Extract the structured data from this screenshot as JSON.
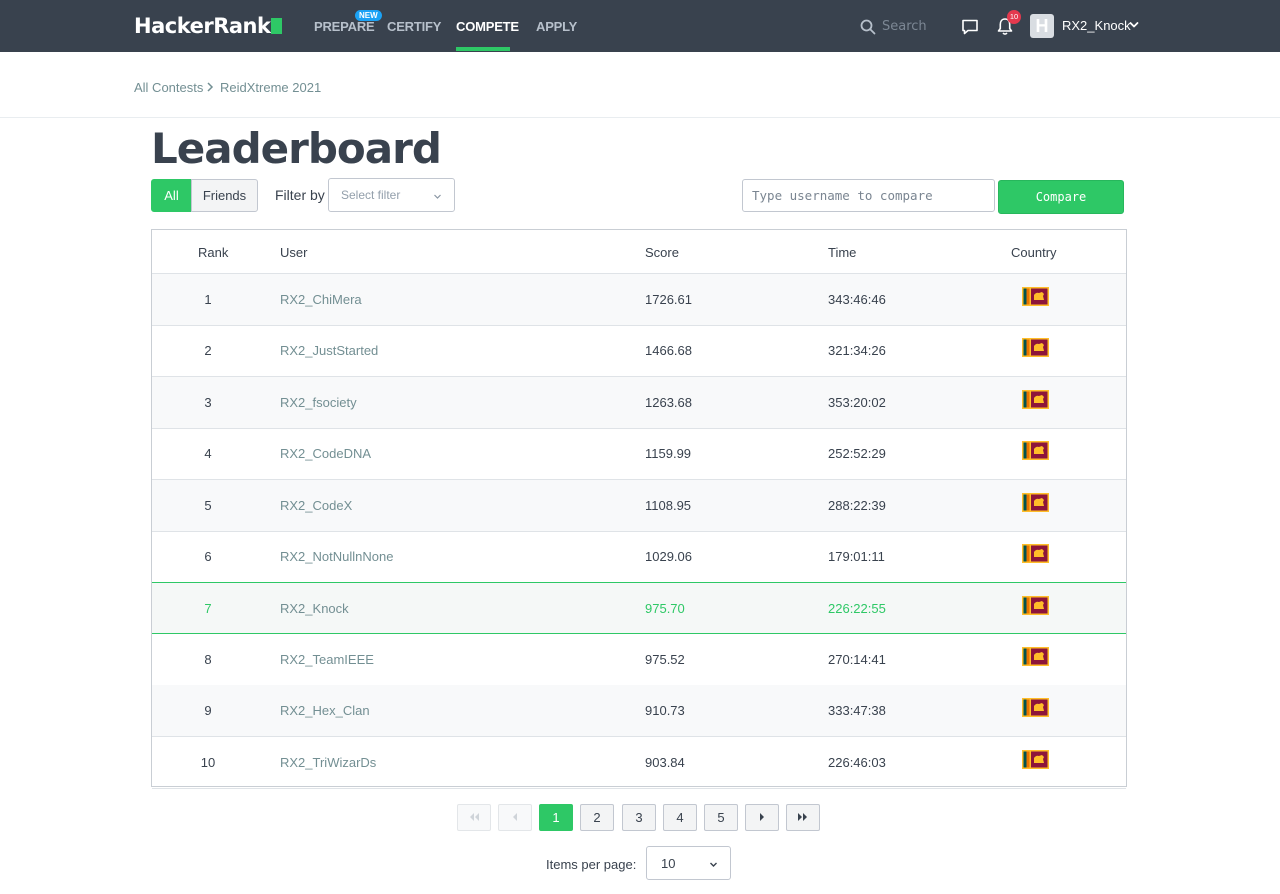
{
  "brand": {
    "name": "HackerRank",
    "accent": "#2ec866",
    "nav_bg": "#39424e"
  },
  "nav": {
    "items": [
      {
        "label": "PREPARE",
        "badge": "NEW"
      },
      {
        "label": "CERTIFY"
      },
      {
        "label": "COMPETE",
        "active": true
      },
      {
        "label": "APPLY"
      }
    ],
    "search_placeholder": "Search",
    "notification_count": "10",
    "avatar_letter": "H",
    "username": "RX2_Knock",
    "icons": [
      "search-icon",
      "chat-icon",
      "bell-icon",
      "chevron-down-icon"
    ]
  },
  "breadcrumb": {
    "items": [
      "All Contests",
      "ReidXtreme 2021"
    ]
  },
  "page": {
    "title": "Leaderboard"
  },
  "filters": {
    "all_label": "All",
    "friends_label": "Friends",
    "filter_label": "Filter by",
    "filter_placeholder": "Select filter",
    "compare_placeholder": "Type username to compare",
    "compare_label": "Compare"
  },
  "table": {
    "headers": {
      "rank": "Rank",
      "user": "User",
      "score": "Score",
      "time": "Time",
      "country": "Country"
    },
    "rows": [
      {
        "rank": "1",
        "user": "RX2_ChiMera",
        "score": "1726.61",
        "time": "343:46:46",
        "country_flag": "sri-lanka-flag-icon"
      },
      {
        "rank": "2",
        "user": "RX2_JustStarted",
        "score": "1466.68",
        "time": "321:34:26",
        "country_flag": "sri-lanka-flag-icon"
      },
      {
        "rank": "3",
        "user": "RX2_fsociety",
        "score": "1263.68",
        "time": "353:20:02",
        "country_flag": "sri-lanka-flag-icon"
      },
      {
        "rank": "4",
        "user": "RX2_CodeDNA",
        "score": "1159.99",
        "time": "252:52:29",
        "country_flag": "sri-lanka-flag-icon"
      },
      {
        "rank": "5",
        "user": "RX2_CodeX",
        "score": "1108.95",
        "time": "288:22:39",
        "country_flag": "sri-lanka-flag-icon"
      },
      {
        "rank": "6",
        "user": "RX2_NotNullnNone",
        "score": "1029.06",
        "time": "179:01:11",
        "country_flag": "sri-lanka-flag-icon"
      },
      {
        "rank": "7",
        "user": "RX2_Knock",
        "score": "975.70",
        "time": "226:22:55",
        "country_flag": "sri-lanka-flag-icon",
        "current_user": true
      },
      {
        "rank": "8",
        "user": "RX2_TeamIEEE",
        "score": "975.52",
        "time": "270:14:41",
        "country_flag": "sri-lanka-flag-icon"
      },
      {
        "rank": "9",
        "user": "RX2_Hex_Clan",
        "score": "910.73",
        "time": "333:47:38",
        "country_flag": "sri-lanka-flag-icon"
      },
      {
        "rank": "10",
        "user": "RX2_TriWizarDs",
        "score": "903.84",
        "time": "226:46:03",
        "country_flag": "sri-lanka-flag-icon"
      }
    ]
  },
  "pagination": {
    "pages": [
      "1",
      "2",
      "3",
      "4",
      "5"
    ],
    "current": "1",
    "items_per_page_label": "Items per page:",
    "items_per_page": "10"
  }
}
